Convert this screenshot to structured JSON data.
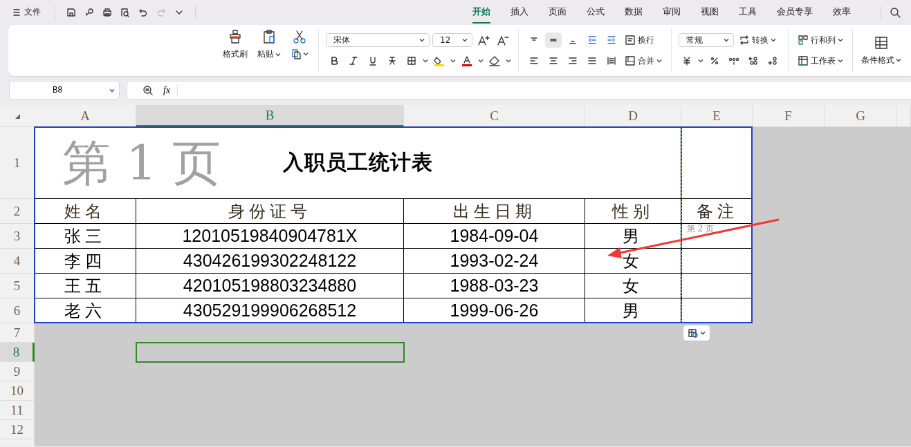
{
  "quick_toolbar": {
    "file_menu": "文件"
  },
  "ribbon_tabs": [
    {
      "label": "开始",
      "selected": true
    },
    {
      "label": "插入",
      "selected": false
    },
    {
      "label": "页面",
      "selected": false
    },
    {
      "label": "公式",
      "selected": false
    },
    {
      "label": "数据",
      "selected": false
    },
    {
      "label": "审阅",
      "selected": false
    },
    {
      "label": "视图",
      "selected": false
    },
    {
      "label": "工具",
      "selected": false
    },
    {
      "label": "会员专享",
      "selected": false
    },
    {
      "label": "效率",
      "selected": false
    }
  ],
  "ribbon": {
    "format_painter": "格式刷",
    "paste": "粘贴",
    "font_name": "宋体",
    "font_size": "12",
    "wrap_text": "换行",
    "merge": "合并",
    "number_format": "常规",
    "convert": "转换",
    "rows_columns": "行和列",
    "worksheet": "工作表",
    "conditional_format": "条件格式"
  },
  "formula_bar": {
    "cell_ref": "B8",
    "fx": "fx"
  },
  "sheet": {
    "columns": [
      {
        "label": "A",
        "selected": false
      },
      {
        "label": "B",
        "selected": true
      },
      {
        "label": "C",
        "selected": false
      },
      {
        "label": "D",
        "selected": false
      },
      {
        "label": "E",
        "selected": false
      },
      {
        "label": "F",
        "selected": false
      },
      {
        "label": "G",
        "selected": false
      }
    ],
    "rows": [
      {
        "label": "1",
        "selected": false
      },
      {
        "label": "2",
        "selected": false
      },
      {
        "label": "3",
        "selected": false
      },
      {
        "label": "4",
        "selected": false
      },
      {
        "label": "5",
        "selected": false
      },
      {
        "label": "6",
        "selected": false
      },
      {
        "label": "7",
        "selected": false
      },
      {
        "label": "8",
        "selected": true
      },
      {
        "label": "9",
        "selected": false
      },
      {
        "label": "10",
        "selected": false
      },
      {
        "label": "11",
        "selected": false
      },
      {
        "label": "12",
        "selected": false
      }
    ],
    "title": "入职员工统计表",
    "header": [
      {
        "text": "姓名",
        "page_break_before": false
      },
      {
        "text": "身份证号",
        "page_break_before": false
      },
      {
        "text": "出生日期",
        "page_break_before": false
      },
      {
        "text": "性别",
        "page_break_before": false
      },
      {
        "text": "备注",
        "page_break_before": true
      }
    ],
    "data_rows": [
      [
        "张三",
        "12010519840904781X",
        "1984-09-04",
        "男",
        ""
      ],
      [
        "李四",
        "430426199302248122",
        "1993-02-24",
        "女",
        ""
      ],
      [
        "王五",
        "420105198803234880",
        "1988-03-23",
        "女",
        ""
      ],
      [
        "老六",
        "430529199906268512",
        "1999-06-26",
        "男",
        ""
      ]
    ],
    "page_labels": [
      "第 1 页",
      "第 2 页"
    ]
  }
}
